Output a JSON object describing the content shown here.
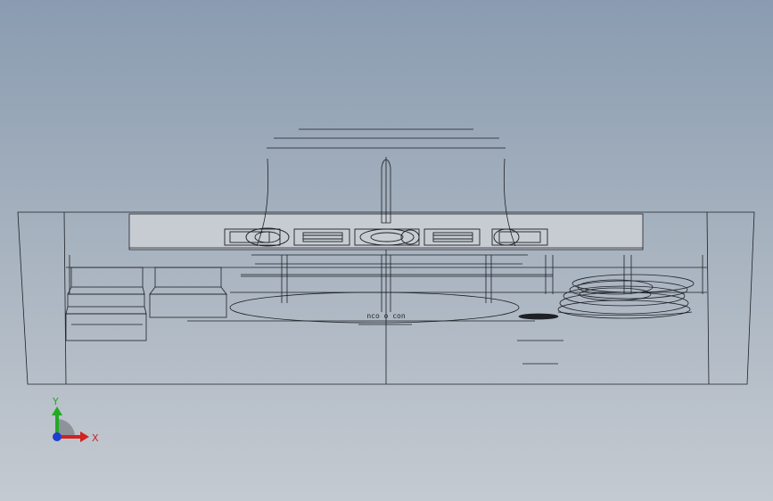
{
  "viewport": {
    "background_top": "#8a9cb1",
    "background_bottom": "#c4cad1",
    "edge_color": "#1e2126"
  },
  "triad": {
    "x_label": "X",
    "y_label": "Y",
    "x_color": "#d22222",
    "y_color": "#22aa22",
    "z_color": "#1f3fd0"
  },
  "panel": {
    "text": "nco o con"
  }
}
